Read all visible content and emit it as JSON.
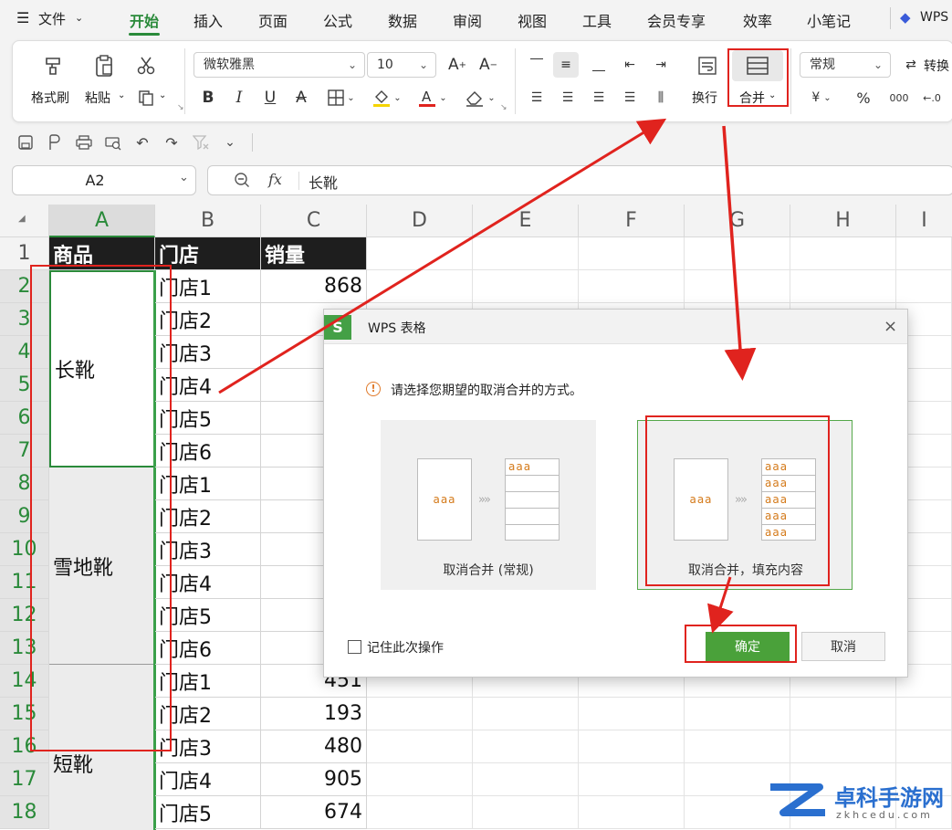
{
  "menubar": {
    "file": "文件",
    "tabs": [
      "开始",
      "插入",
      "页面",
      "公式",
      "数据",
      "审阅",
      "视图",
      "工具",
      "会员专享",
      "效率",
      "小笔记"
    ],
    "brand": "WPS"
  },
  "ribbon": {
    "format_painter": "格式刷",
    "paste": "粘贴",
    "font_name": "微软雅黑",
    "font_size": "10",
    "bold": "B",
    "italic": "I",
    "underline": "U",
    "wrap": "换行",
    "merge": "合并",
    "number_format": "常规",
    "convert": "转换",
    "yen": "¥",
    "percent": "%",
    "thousands": "000"
  },
  "namebox": {
    "value": "A2"
  },
  "formulabar": {
    "fx": "fx",
    "value": "长靴"
  },
  "grid": {
    "columns": [
      "A",
      "B",
      "C",
      "D",
      "E",
      "F",
      "G",
      "H",
      "I"
    ],
    "rows": [
      "1",
      "2",
      "3",
      "4",
      "5",
      "6",
      "7",
      "8",
      "9",
      "10",
      "11",
      "12",
      "13",
      "14",
      "15",
      "16",
      "17",
      "18"
    ],
    "headers": [
      "商品",
      "门店",
      "销量"
    ],
    "groups": [
      {
        "label": "长靴"
      },
      {
        "label": "雪地靴"
      },
      {
        "label": "短靴"
      }
    ],
    "stores": [
      "门店1",
      "门店2",
      "门店3",
      "门店4",
      "门店5",
      "门店6",
      "门店1",
      "门店2",
      "门店3",
      "门店4",
      "门店5",
      "门店6",
      "门店1",
      "门店2",
      "门店3",
      "门店4",
      "门店5"
    ],
    "sales": [
      "868",
      "",
      "",
      "",
      "",
      "",
      "",
      "",
      "",
      "",
      "",
      "",
      "451",
      "193",
      "480",
      "905",
      "674"
    ]
  },
  "dialog": {
    "title": "WPS 表格",
    "prompt": "请选择您期望的取消合并的方式。",
    "sample": "aaa",
    "option1": "取消合并 (常规)",
    "option2": "取消合并，填充内容",
    "remember": "记住此次操作",
    "ok": "确定",
    "cancel": "取消"
  },
  "watermark": {
    "title": "卓科手游网",
    "sub": "zkhcedu.com"
  },
  "colors": {
    "accent": "#2a8a3a",
    "ok_button": "#4aa13a",
    "annotation": "#e0231e"
  }
}
